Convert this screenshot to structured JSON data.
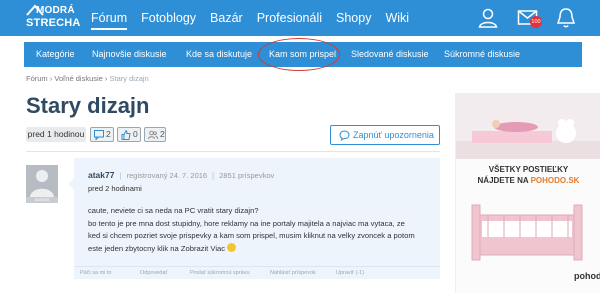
{
  "header": {
    "logo_line1": "MODRÁ",
    "logo_line2": "STRECHA",
    "nav": [
      "Fórum",
      "Fotoblogy",
      "Bazár",
      "Profesionáli",
      "Shopy",
      "Wiki"
    ],
    "active_nav": "Fórum",
    "mail_badge": "100",
    "colors": {
      "brand_blue": "#2f8fd6",
      "badge_red": "#e5313a"
    }
  },
  "subnav": {
    "items": [
      "Kategórie",
      "Najnovšie diskusie",
      "Kde sa diskutuje",
      "Kam som prispel",
      "Sledované diskusie",
      "Súkromné diskusie"
    ]
  },
  "breadcrumb": {
    "items": [
      "Fórum",
      "Voľné diskusie",
      "Stary dizajn"
    ]
  },
  "thread": {
    "title": "Stary dizajn",
    "time": "pred 1 hodinou",
    "stats": {
      "comments": "2",
      "likes": "0",
      "views": "2"
    },
    "watch_button": "Zapnúť upozornenia"
  },
  "post": {
    "author": "atak77",
    "registered": "registrovaný 24. 7. 2016",
    "posts": "2851 príspevkov",
    "avatar_label": "AVATAR",
    "time": "pred 2 hodinami",
    "body": [
      "caute, neviete ci sa neda na PC vratit stary dizajn?",
      "bo tento je pre mna dost stupidny, hore reklamy na ine portaly majitela a najviac ma vytaca, ze",
      "ked si chcem pozriet svoje prispevky a kam som prispel, musim kliknut na velky zvoncek a potom",
      "este jeden zbytocny klik na Zobrazit Viac"
    ],
    "actions": [
      "Páči sa mi to",
      "Odpovedať",
      "Poslať súkromnú správu",
      "Nahlásiť príspevok",
      "Upraviť (-1)"
    ]
  },
  "ad": {
    "line1": "VŠETKY POSTIEĽKY",
    "line2_prefix": "NÁJDETE NA ",
    "line2_brand": "POHODO.SK",
    "logo": "pohodo"
  }
}
